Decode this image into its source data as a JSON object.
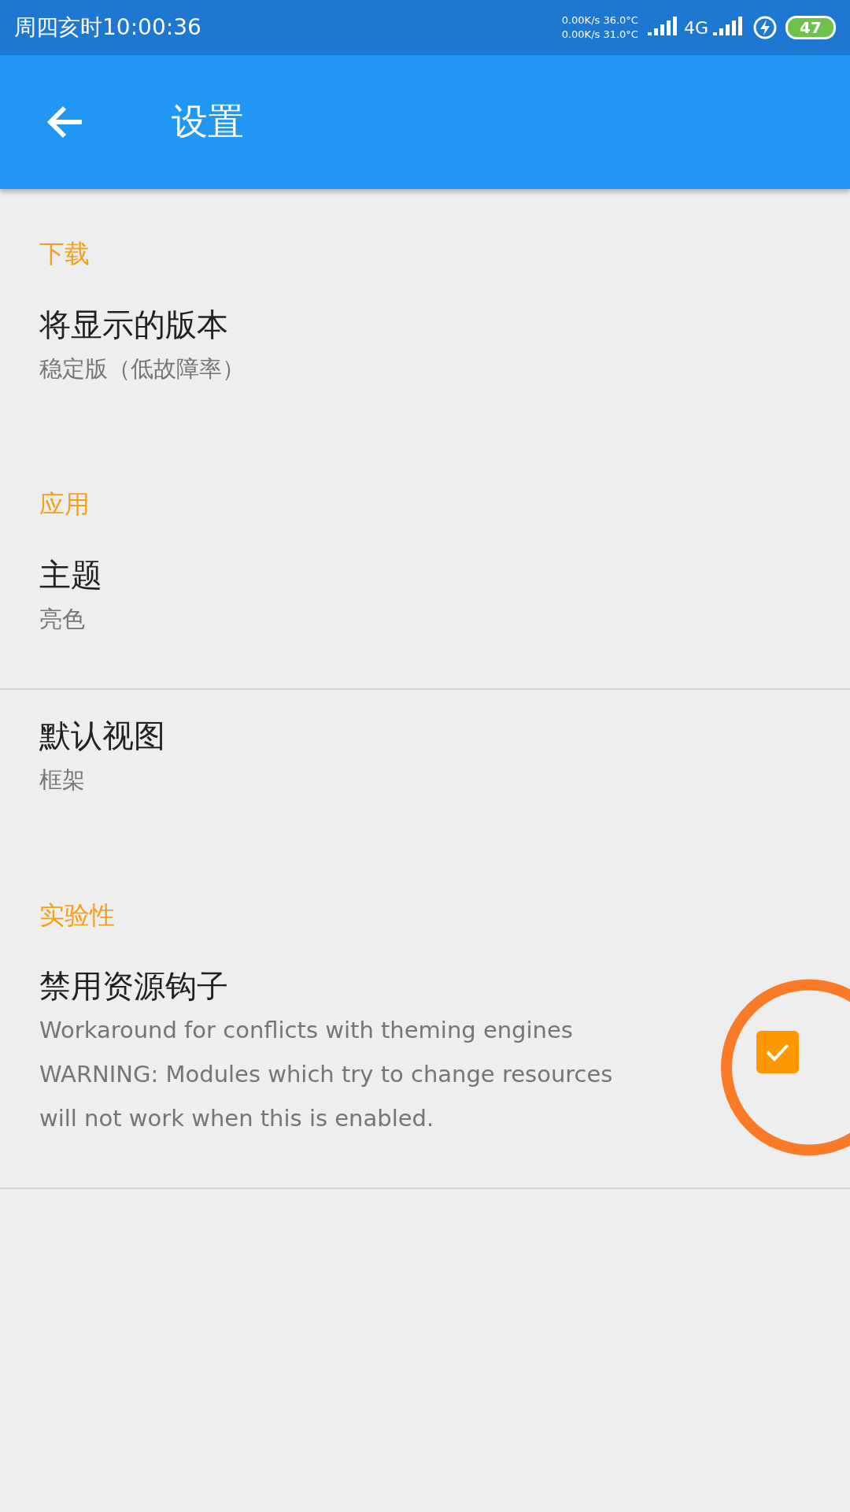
{
  "status_bar": {
    "time": "周四亥时10:00:36",
    "speeds": [
      "0.00K/s 36.0°C",
      "0.00K/s 31.0°C"
    ],
    "network": "4G",
    "battery": "47"
  },
  "app_bar": {
    "title": "设置"
  },
  "sections": [
    {
      "header": "下载",
      "items": [
        {
          "kind": "text",
          "title": "将显示的版本",
          "summary": "稳定版（低故障率）",
          "divider": false
        }
      ]
    },
    {
      "header": "应用",
      "items": [
        {
          "kind": "text",
          "title": "主题",
          "summary": "亮色",
          "divider": true
        },
        {
          "kind": "text",
          "title": "默认视图",
          "summary": "框架",
          "divider": false
        }
      ]
    },
    {
      "header": "实验性",
      "items": [
        {
          "kind": "checkbox",
          "title": "禁用资源钩子",
          "summary": "Workaround for conflicts with theming engines\nWARNING: Modules which try to change resources will not work when this is enabled.",
          "checked": true,
          "highlighted": true,
          "divider": true
        }
      ]
    }
  ]
}
